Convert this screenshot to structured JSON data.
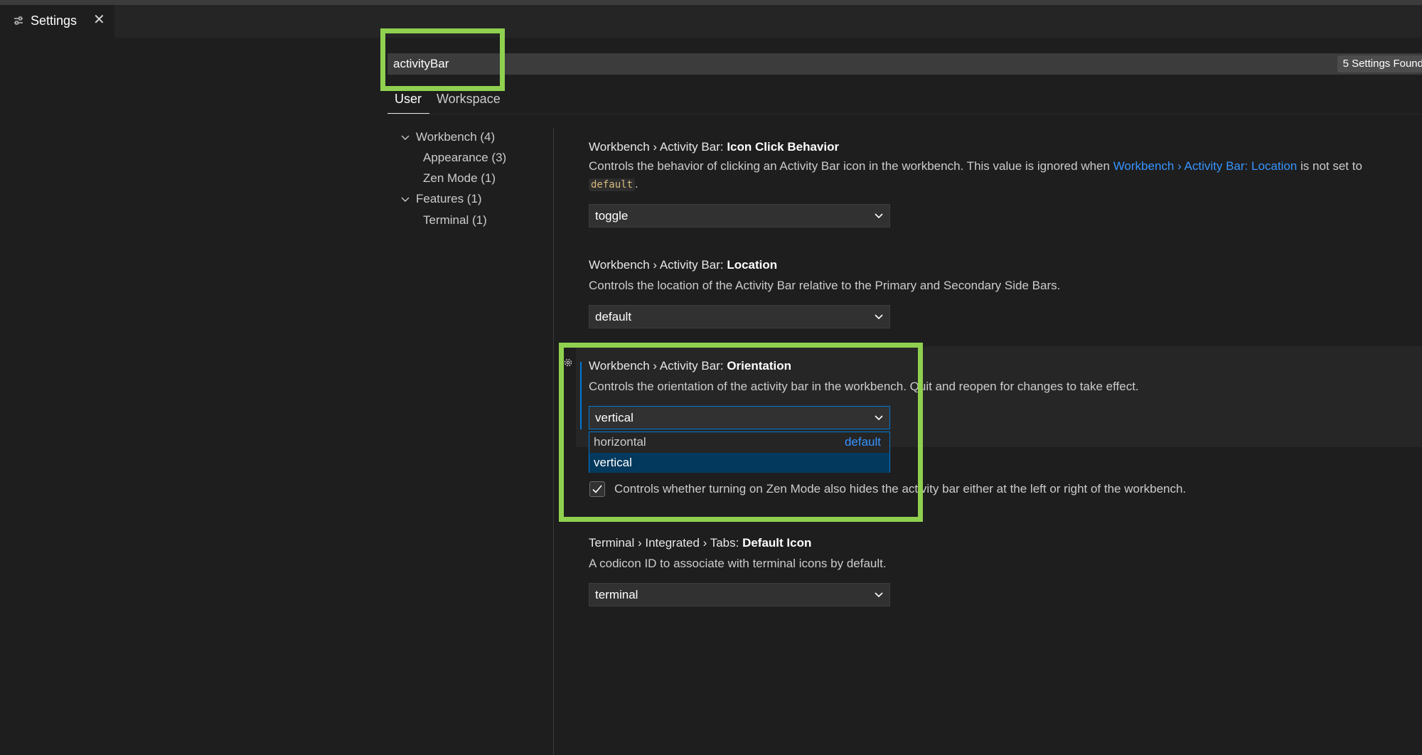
{
  "tab": {
    "label": "Settings",
    "icon": "settings-sliders-icon",
    "close_glyph": "✕"
  },
  "search": {
    "value": "activityBar",
    "results": "5 Settings Found"
  },
  "scopes": {
    "user": "User",
    "workspace": "Workspace"
  },
  "toc": {
    "workbench": "Workbench (4)",
    "appearance": "Appearance (3)",
    "zen_mode": "Zen Mode (1)",
    "features": "Features (1)",
    "terminal": "Terminal (1)"
  },
  "settings": {
    "icon_click": {
      "prefix": "Workbench › Activity Bar: ",
      "name": "Icon Click Behavior",
      "desc_1": "Controls the behavior of clicking an Activity Bar icon in the workbench. This value is ignored when ",
      "desc_link": "Workbench › Activity Bar: Location",
      "desc_2": " is not set to",
      "desc_code": "default",
      "desc_end": ".",
      "value": "toggle"
    },
    "location": {
      "prefix": "Workbench › Activity Bar: ",
      "name": "Location",
      "desc": "Controls the location of the Activity Bar relative to the Primary and Secondary Side Bars.",
      "value": "default"
    },
    "orientation": {
      "prefix": "Workbench › Activity Bar: ",
      "name": "Orientation",
      "desc": "Controls the orientation of the activity bar in the workbench. Quit and reopen for changes to take effect.",
      "value": "vertical",
      "options": [
        {
          "label": "horizontal",
          "tag": "default"
        },
        {
          "label": "vertical"
        }
      ]
    },
    "zen_hide": {
      "desc": "Controls whether turning on Zen Mode also hides the activity bar either at the left or right of the workbench.",
      "checked": true
    },
    "terminal_icon": {
      "prefix": "Terminal › Integrated › Tabs: ",
      "name": "Default Icon",
      "desc": "A codicon ID to associate with terminal icons by default.",
      "value": "terminal"
    }
  },
  "colors": {
    "accent": "#0078d4",
    "link": "#3794ff",
    "annotation": "#8fd14f",
    "selected_option": "#04395e"
  }
}
